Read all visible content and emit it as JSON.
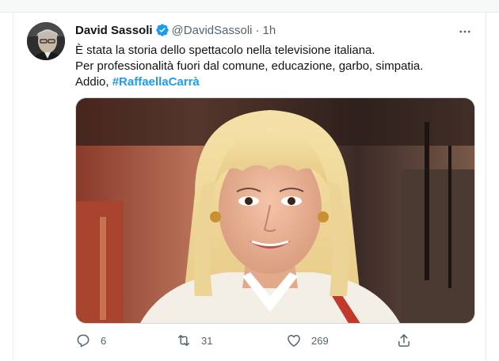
{
  "tweet": {
    "author_name": "David Sassoli",
    "handle": "@DavidSassoli",
    "separator": "·",
    "time": "1h",
    "text_line1": "È stata la storia dello spettacolo nella televisione italiana.",
    "text_line2": "Per professionalità fuori dal comune, educazione, garbo, simpatia.",
    "text_line3_prefix": "Addio, ",
    "hashtag": "#RaffaellaCarrà"
  },
  "actions": {
    "reply_count": "6",
    "retweet_count": "31",
    "like_count": "269"
  },
  "icons": {
    "verified": "verified-badge-icon",
    "more": "more-options-icon",
    "reply": "reply-icon",
    "retweet": "retweet-icon",
    "like": "heart-icon",
    "share": "share-icon"
  },
  "colors": {
    "accent": "#1d9bf0",
    "text": "#0f1419",
    "muted": "#536471"
  }
}
